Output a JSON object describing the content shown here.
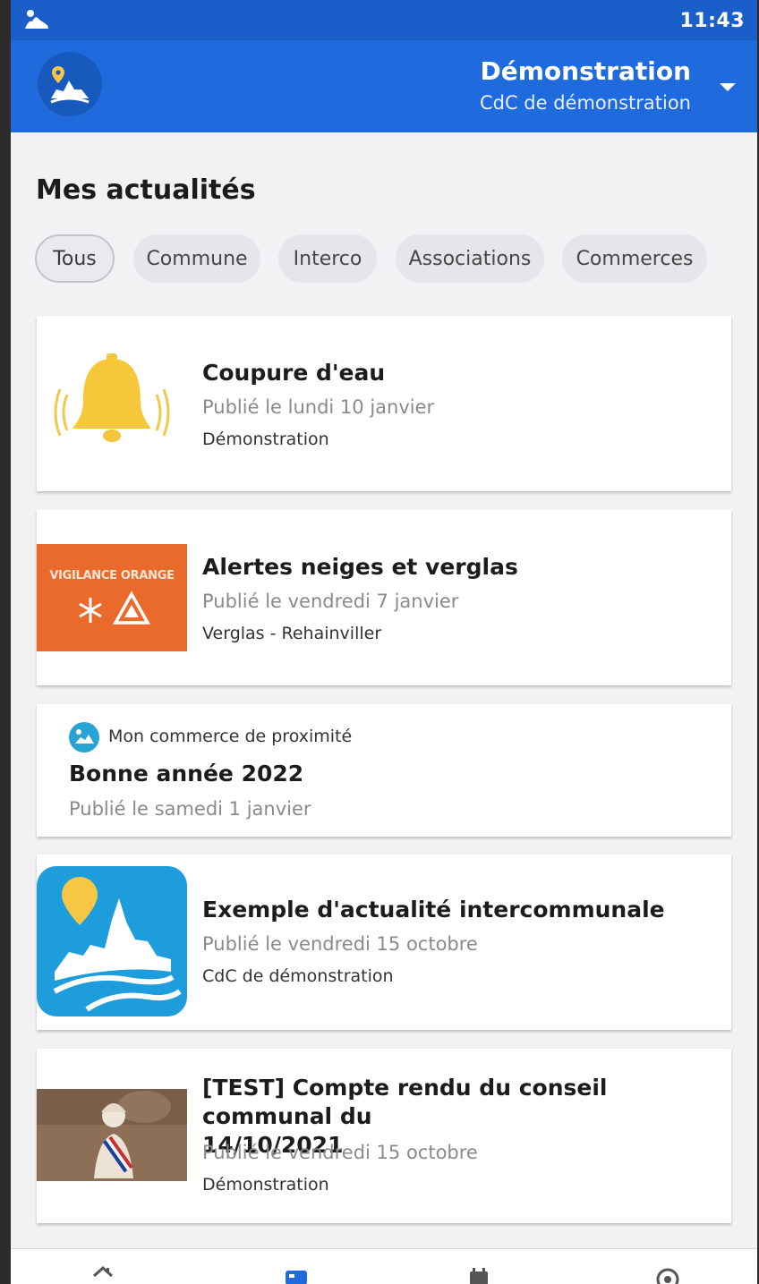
{
  "status_bar": {
    "time": "11:43"
  },
  "header": {
    "title": "Démonstration",
    "subtitle": "CdC de démonstration",
    "dropdown_icon": "chevron-down-icon",
    "brand_color": "#1f6bde"
  },
  "page": {
    "title": "Mes actualités"
  },
  "filters": [
    {
      "label": "Tous",
      "selected": true
    },
    {
      "label": "Commune",
      "selected": false
    },
    {
      "label": "Interco",
      "selected": false
    },
    {
      "label": "Associations",
      "selected": false
    },
    {
      "label": "Commerces",
      "selected": false
    }
  ],
  "news": [
    {
      "title": "Coupure d'eau",
      "date": "Publié le lundi 10 janvier",
      "source": "Démonstration",
      "thumbnail_icon": "bell-icon"
    },
    {
      "title": "Alertes neiges et verglas",
      "date": "Publié le vendredi 7 janvier",
      "source": "Verglas - Rehainviller",
      "thumbnail_text": "VIGILANCE ORANGE",
      "thumbnail_icon": "snow-warning-icon"
    },
    {
      "tag": "Mon commerce de proximité",
      "tag_icon": "shop-icon",
      "title": "Bonne année 2022",
      "date": "Publié le samedi 1 janvier"
    },
    {
      "title": "Exemple d'actualité intercommunale",
      "date": "Publié le vendredi 15 octobre",
      "source": "CdC de démonstration",
      "thumbnail_icon": "interco-logo-icon"
    },
    {
      "title_line1": "[TEST] Compte rendu du conseil communal du",
      "title_line2": "14/10/2021",
      "date": "Publié le vendredi 15 octobre",
      "source": "Démonstration",
      "thumbnail_icon": "marianne-bust-image"
    }
  ],
  "bottom_nav": [
    {
      "icon": "home-icon"
    },
    {
      "icon": "news-icon",
      "active": true
    },
    {
      "icon": "calendar-icon"
    },
    {
      "icon": "alert-icon"
    }
  ]
}
